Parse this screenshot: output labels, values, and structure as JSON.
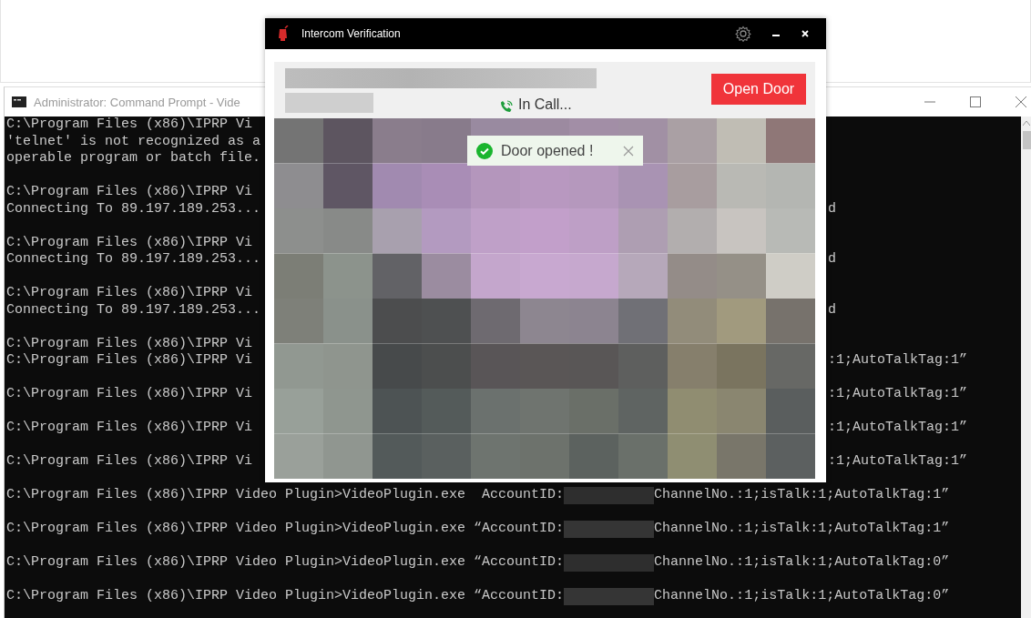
{
  "console_window": {
    "title": "Administrator: Command Prompt - Vide",
    "lines": [
      {
        "kind": "text",
        "left": "C:\\Program Files (x86)\\IPRP Vi"
      },
      {
        "kind": "text",
        "left": "'telnet' is not recognized as a"
      },
      {
        "kind": "text",
        "left": "operable program or batch file."
      },
      {
        "kind": "blank"
      },
      {
        "kind": "text",
        "left": "C:\\Program Files (x86)\\IPRP Vi"
      },
      {
        "kind": "split",
        "left": "Connecting To 89.197.189.253...",
        "right": "d"
      },
      {
        "kind": "blank"
      },
      {
        "kind": "text",
        "left": "C:\\Program Files (x86)\\IPRP Vi"
      },
      {
        "kind": "split",
        "left": "Connecting To 89.197.189.253...",
        "right": "d"
      },
      {
        "kind": "blank"
      },
      {
        "kind": "text",
        "left": "C:\\Program Files (x86)\\IPRP Vi"
      },
      {
        "kind": "split",
        "left": "Connecting To 89.197.189.253...",
        "right": "d"
      },
      {
        "kind": "blank"
      },
      {
        "kind": "text",
        "left": "C:\\Program Files (x86)\\IPRP Vi"
      },
      {
        "kind": "split",
        "left": "C:\\Program Files (x86)\\IPRP Vi",
        "right": ":1;AutoTalkTag:1”"
      },
      {
        "kind": "blank"
      },
      {
        "kind": "split",
        "left": "C:\\Program Files (x86)\\IPRP Vi",
        "right": ":1;AutoTalkTag:1”"
      },
      {
        "kind": "blank"
      },
      {
        "kind": "split",
        "left": "C:\\Program Files (x86)\\IPRP Vi",
        "right": ":1;AutoTalkTag:1”"
      },
      {
        "kind": "blank"
      },
      {
        "kind": "split",
        "left": "C:\\Program Files (x86)\\IPRP Vi",
        "right": ":1;AutoTalkTag:1”"
      },
      {
        "kind": "blank"
      },
      {
        "kind": "redacted",
        "left": "C:\\Program Files (x86)\\IPRP Video Plugin>VideoPlugin.exe  AccountID:",
        "right": "ChannelNo.:1;isTalk:1;AutoTalkTag:1”"
      },
      {
        "kind": "blank"
      },
      {
        "kind": "redacted",
        "left": "C:\\Program Files (x86)\\IPRP Video Plugin>VideoPlugin.exe “AccountID:",
        "right": "ChannelNo.:1;isTalk:1;AutoTalkTag:1”"
      },
      {
        "kind": "blank"
      },
      {
        "kind": "redacted",
        "left": "C:\\Program Files (x86)\\IPRP Video Plugin>VideoPlugin.exe “AccountID:",
        "right": "ChannelNo.:1;isTalk:1;AutoTalkTag:0”"
      },
      {
        "kind": "blank"
      },
      {
        "kind": "redacted",
        "left": "C:\\Program Files (x86)\\IPRP Video Plugin>VideoPlugin.exe “AccountID:",
        "right": "ChannelNo.:1;isTalk:1;AutoTalkTag:0”"
      }
    ]
  },
  "dialog": {
    "title": "Intercom Verification",
    "status": "In Call...",
    "open_door_button": "Open Door",
    "toast": {
      "message": "Door opened !"
    }
  }
}
